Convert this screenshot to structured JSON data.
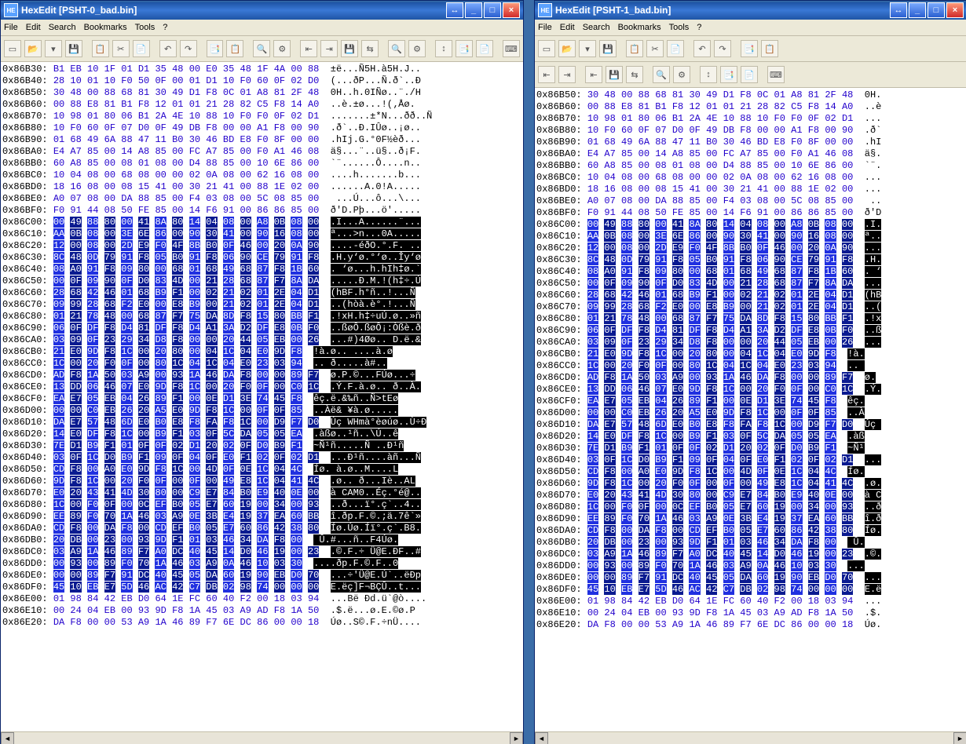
{
  "left": {
    "title": "HexEdit [PSHT-0_bad.bin]",
    "icon_label": "HE",
    "sysbtns": [
      "↔",
      "_",
      "□",
      "×"
    ],
    "menu": [
      "File",
      "Edit",
      "Search",
      "Bookmarks",
      "Tools",
      "?"
    ],
    "toolbar_icons": [
      "▭",
      "📂",
      "▾",
      "💾",
      "",
      "📋",
      "✂",
      "📄",
      "",
      "↶",
      "↷",
      "",
      "📑",
      "📋",
      "",
      "🔍",
      "⚙",
      "",
      "⇤",
      "⇥",
      "💾",
      "⇆",
      "",
      "🔍",
      "⚙",
      "",
      "↕",
      "📑",
      "📄",
      "",
      "⌨"
    ],
    "icon_semantics": [
      "new-icon",
      "open-icon",
      "dropdown-icon",
      "save-icon",
      "sep",
      "copy-icon",
      "cut-icon",
      "paste-icon",
      "sep",
      "undo-icon",
      "redo-icon",
      "sep",
      "clipboard-icon",
      "stack-icon",
      "sep",
      "find-icon",
      "settings-icon",
      "sep",
      "goto-start-icon",
      "goto-end-icon",
      "save2-icon",
      "swap-icon",
      "sep",
      "binoculars-icon",
      "lightning-icon",
      "sep",
      "sort-icon",
      "doc-icon",
      "doc2-icon",
      "sep",
      "keyboard-icon"
    ],
    "selection_start": 15
  },
  "right": {
    "title": "HexEdit [PSHT-1_bad.bin]",
    "icon_label": "HE",
    "sysbtns": [
      "↔",
      "_",
      "□",
      "×"
    ],
    "menu": [
      "File",
      "Edit",
      "Search",
      "Bookmarks",
      "Tools",
      "?"
    ],
    "toolbar1_icons": [
      "▭",
      "📂",
      "▾",
      "💾",
      "",
      "📋",
      "✂",
      "📄",
      "",
      "↶",
      "↷",
      "",
      "📑",
      "📋"
    ],
    "toolbar2_icons": [
      "⇤",
      "⇥",
      "",
      "⇤",
      "💾",
      "⇆",
      "",
      "🔍",
      "⚙",
      "",
      "↕",
      "📑",
      "📄",
      "",
      "⌨"
    ],
    "selection_start": 5
  },
  "rows": [
    {
      "a": "0x86B30:",
      "h": "B1 EB 10 1F 01 D1 35 48 00 E0 35 48 1F 4A 00 88",
      "t": "±ë...Ñ5H.à5H.J.."
    },
    {
      "a": "0x86B40:",
      "h": "28 10 01 10 F0 50 0F 00 01 D1 10 F0 60 0F 02 D0",
      "t": "(...ðP...Ñ.ð`..Ð"
    },
    {
      "a": "0x86B50:",
      "h": "30 48 00 88 68 81 30 49 D1 F8 0C 01 A8 81 2F 48",
      "t": "0H..h.0IÑø..¨./H"
    },
    {
      "a": "0x86B60:",
      "h": "00 88 E8 81 B1 F8 12 01 01 21 28 82 C5 F8 14 A0",
      "t": "..è.±ø...!(‚Åø. "
    },
    {
      "a": "0x86B70:",
      "h": "10 98 01 80 06 B1 2A 4E 10 88 10 F0 F0 0F 02 D1",
      "t": ".......±*N...ðð..Ñ"
    },
    {
      "a": "0x86B80:",
      "h": "10 F0 60 0F 07 D0 0F 49 DB F8 00 00 A1 F8 00 90",
      "t": ".ð`..Ð.IÛø..¡ø.."
    },
    {
      "a": "0x86B90:",
      "h": "01 68 49 6A 88 47 11 B0 30 46 BD E8 F0 8F 00 00",
      "t": ".hIj.G.°0F½èð..."
    },
    {
      "a": "0x86BA0:",
      "h": "E4 A7 85 00 14 A8 85 00 FC A7 85 00 F0 A1 46 08",
      "t": "ä§...¨..ü§..ð¡F."
    },
    {
      "a": "0x86BB0:",
      "h": "60 A8 85 00 08 01 08 00 D4 88 85 00 10 6E 86 00",
      "t": "`¨......Ô....n.."
    },
    {
      "a": "0x86BC0:",
      "h": "10 04 08 00 68 08 00 00 02 0A 08 00 62 16 08 00",
      "t": "....h.......b..."
    },
    {
      "a": "0x86BD0:",
      "h": "18 16 08 00 08 15 41 00 30 21 41 00 88 1E 02 00",
      "t": "......A.0!A....."
    },
    {
      "a": "0x86BE0:",
      "h": "A0 07 08 00 DA 88 85 00 F4 03 08 00 5C 08 85 00",
      "t": " ...Ú...ô...\\..."
    },
    {
      "a": "0x86BF0:",
      "h": "F0 91 44 08 50 FE 85 00 14 F6 91 00 86 86 85 00",
      "t": "ð'D.Pþ...ö'....."
    },
    {
      "a": "0x86C00:",
      "h": "00 49 88 80 00 41 8A 80 14 04 08 00 A8 0B 08 00",
      "t": ".I...A......¨...",
      "s": 1
    },
    {
      "a": "0x86C10:",
      "h": "AA 0B 08 00 3E 6E 86 00 90 30 41 00 90 16 08 00",
      "t": "ª...>n...0A.....",
      "s": 1
    },
    {
      "a": "0x86C20:",
      "h": "12 00 08 00 2D E9 F0 4F 8B B0 0F 46 00 20 0A 90",
      "t": "....-éðO.°.F. ..",
      "s": 1
    },
    {
      "a": "0x86C30:",
      "h": "8C 48 0D 79 91 F8 05 B0 91 F8 06 90 CE 79 91 F8",
      "t": ".H.y‘ø.°‘ø..Îy‘ø",
      "s": 1
    },
    {
      "a": "0x86C40:",
      "h": "08 A0 91 F8 09 80 00 68 01 68 49 68 87 F8 1B 60",
      "t": ". ‘ø...h.hIh‡ø.`",
      "s": 1
    },
    {
      "a": "0x86C50:",
      "h": "00 0F 09 90 0F D0 83 4D 00 21 28 68 87 F7 8A DA",
      "t": ".....Ð.M.!(h‡÷.Ú",
      "s": 1
    },
    {
      "a": "0x86C60:",
      "h": "28 68 42 46 01 68 B9 F1 00 02 21 02 01 2E 04 D1",
      "t": "(hBF.h°ñ..!...Ñ",
      "s": 1
    },
    {
      "a": "0x86C70:",
      "h": "09 99 28 68 F2 E0 00 E8 B9 00 21 02 01 2E 04 D1",
      "t": "..(hòà.è°.!...Ñ",
      "s": 1
    },
    {
      "a": "0x86C80:",
      "h": "01 21 78 48 00 68 87 F7 75 DA 8D F8 15 80 BB F1",
      "t": ".!xH.h‡÷uÚ.ø..»ñ",
      "s": 1
    },
    {
      "a": "0x86C90:",
      "h": "06 0F DF F8 D4 81 DF F8 D4 A1 3A D2 DF E8 0B F0",
      "t": "..ßøÔ.ßøÔ¡:Òßè.ð",
      "s": 1
    },
    {
      "a": "0x86CA0:",
      "h": "03 09 0F 23 29 34 D8 F8 00 00 20 44 05 EB 00 26",
      "t": "...#)4Øø.. D.ë.&",
      "s": 1
    },
    {
      "a": "0x86CB0:",
      "h": "21 E0 9D F8 1C 00 20 80 00 04 1C 04 E0 9D F8",
      "t": "!à.ø.. ....à.ø",
      "s": 1
    },
    {
      "a": "0x86CC0:",
      "h": "1C 00 20 F0 0F 00 80 1C 04 1C 04 E0 23 03 94",
      "t": ".. ð.....à#..",
      "s": 1
    },
    {
      "a": "0x86CD0:",
      "h": "AD F8 1A 50 03 A9 00 93 1A 46 DA F8 00 00 89 F7",
      "t": "­ø.P.©...FÚø...÷",
      "s": 1
    },
    {
      "a": "0x86CE0:",
      "h": "13 DD 06 46 07 E0 9D F8 1C 00 20 F0 0F 00 C0 1C",
      "t": ".Ý.F.à.ø.. ð..À.",
      "s": 1
    },
    {
      "a": "0x86CF0:",
      "h": "EA E7 05 EB 04 26 89 F1 00 0E D1 3E 74 45 F8",
      "t": "êç.ë.&‰ñ..Ñ>tEø",
      "s": 1
    },
    {
      "a": "0x86D00:",
      "h": "00 00 C0 EB 26 20 A5 E0 9D F8 1C 00 0F 0F 85",
      "t": "..Àë& ¥à.ø.....",
      "s": 1
    },
    {
      "a": "0x86D10:",
      "h": "DA E7 57 48 6D E0 B0 E8 F8 FA F8 1C 00 D9 F7 D0",
      "t": "Úç WHmà°èøúø..Ù÷Ð",
      "s": 1
    },
    {
      "a": "0x86D20:",
      "h": "14 E0 DF F8 1C 00 B9 F1 03 0F 5C DA 05 05 EA",
      "t": ".àßø..¹ñ..\\Ú..ê",
      "s": 1
    },
    {
      "a": "0x86D30:",
      "h": "7E D1 B9 F1 01 0F 0F 02 D1 20 02 0F D0 B9 F1",
      "t": "~Ñ¹ñ.....Ñ ..Ð¹ñ",
      "s": 1
    },
    {
      "a": "0x86D40:",
      "h": "03 0F 1C D0 B9 F1 09 0F 04 0F E0 F1 02 0F 02 D1",
      "t": "...Ð¹ñ....àñ...Ñ",
      "s": 1
    },
    {
      "a": "0x86D50:",
      "h": "CD F8 00 A0 E0 9D F8 1C 00 4D 0F 0E 1C 04 4C",
      "t": "Íø. à.ø..M....L",
      "s": 1
    },
    {
      "a": "0x86D60:",
      "h": "9D F8 1C 00 20 F0 0F 00 0F 00 49 E8 1C 04 41 4C",
      "t": ".ø.. ð...Iè..AL",
      "s": 1
    },
    {
      "a": "0x86D70:",
      "h": "E0 20 43 41 4D 30 80 00 C9 E7 84 B0 E9 40 0E 00",
      "t": "à CAM0..Éç.°é@..",
      "s": 1
    },
    {
      "a": "0x86D80:",
      "h": "1C 00 F0 0F 00 0C EF B0 05 E7 60 19 00 34 00 93",
      "t": "..ð...ï°.ç`..4..",
      "s": 1
    },
    {
      "a": "0x86D90:",
      "h": "EE 89 F0 70 1A 46 03 A9 0E 3B E4 19 37 EA 60 BB",
      "t": "î.ðp.F.©.;ä.7ê`»",
      "s": 1
    },
    {
      "a": "0x86DA0:",
      "h": "CD F8 00 DA F8 00 CD EF B0 05 E7 60 86 42 38 80",
      "t": "Íø.Úø.Íï°.ç`.B8.",
      "s": 1
    },
    {
      "a": "0x86DB0:",
      "h": "20 DB 00 23 00 93 9D F1 01 03 46 34 DA F8 00",
      "t": " Û.#...ñ..F4Úø.",
      "s": 1
    },
    {
      "a": "0x86DC0:",
      "h": "03 A9 1A 46 89 F7 A0 DC 40 45 14 D0 46 19 00 23",
      "t": ".©.F.÷ Ü@E.ÐF..#",
      "s": 1
    },
    {
      "a": "0x86DD0:",
      "h": "00 93 00 89 F0 70 1A 46 03 A9 0A 46 10 03 30",
      "t": "....ðp.F.©.F..0",
      "s": 1
    },
    {
      "a": "0x86DE0:",
      "h": "00 00 89 F7 91 DC 40 45 05 DA 60 19 90 EB D0 70",
      "t": "...÷'Ü@E.Ú`..ëÐp",
      "s": 1
    },
    {
      "a": "0x86DF0:",
      "h": "45 10 EB E7 5D 46 AC 42 C7 DB 02 98 74 00 00 00",
      "t": "E.ëç]F¬BÇÛ..t...",
      "s": 1
    },
    {
      "a": "0x86E00:",
      "h": "01 98 84 42 EB D0 64 1E FC 60 40 F2 00 18 03 94",
      "t": "...Bë Ðd.ü`@ò...."
    },
    {
      "a": "0x86E10:",
      "h": "00 24 04 EB 00 93 9D F8 1A 45 03 A9 AD F8 1A 50",
      "t": ".$.ë...ø.E.©­ø.P"
    },
    {
      "a": "0x86E20:",
      "h": "DA F8 00 00 53 A9 1A 46 89 F7 6E DC 86 00 00 18",
      "t": "Úø..S©.F.÷nÜ...."
    }
  ],
  "rows_right": [
    "0x86B50:",
    "0x86B60:",
    "0x86B70:",
    "0x86B80:",
    "0x86B90:",
    "0x86BA0:",
    "0x86BB0:",
    "0x86BC0:",
    "0x86BD0:",
    "0x86BE0:",
    "0x86BF0:",
    "0x86C00:",
    "0x86C10:",
    "0x86C20:",
    "0x86C30:",
    "0x86C40:",
    "0x86C50:",
    "0x86C60:",
    "0x86C70:",
    "0x86C80:",
    "0x86C90:",
    "0x86CA0:",
    "0x86CB0:",
    "0x86CC0:",
    "0x86CD0:",
    "0x86CE0:",
    "0x86CF0:",
    "0x86D00:",
    "0x86D10:",
    "0x86D20:",
    "0x86D30:",
    "0x86D40:",
    "0x86D50:",
    "0x86D60:",
    "0x86D70:",
    "0x86D80:",
    "0x86D90:",
    "0x86DA0:",
    "0x86DB0:",
    "0x86DC0:",
    "0x86DD0:",
    "0x86DE0:",
    "0x86DF0:",
    "0x86E00:",
    "0x86E10:",
    "0x86E20:"
  ]
}
